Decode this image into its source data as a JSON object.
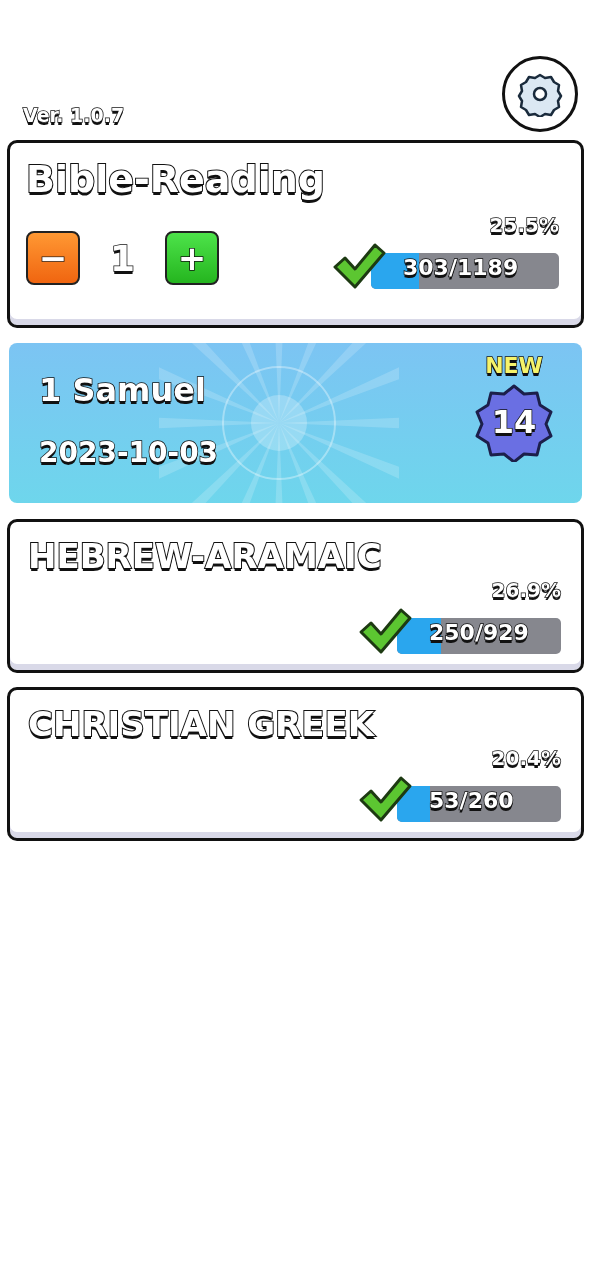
{
  "version": "Ver. 1.0.7",
  "main_card": {
    "title": "Bible-Reading",
    "counter": {
      "minus": "−",
      "value": "1",
      "plus": "+"
    },
    "percent": "25.5%",
    "progress": "303/1189",
    "level": 0.255
  },
  "banner": {
    "book": "1 Samuel",
    "date": "2023-10-03",
    "badge_label": "NEW",
    "badge_number": "14"
  },
  "sections": [
    {
      "title": "HEBREW-ARAMAIC",
      "percent": "26.9%",
      "progress": "250/929",
      "level": 0.269
    },
    {
      "title": "CHRISTIAN GREEK",
      "percent": "20.4%",
      "progress": "53/260",
      "level": 0.204
    }
  ]
}
